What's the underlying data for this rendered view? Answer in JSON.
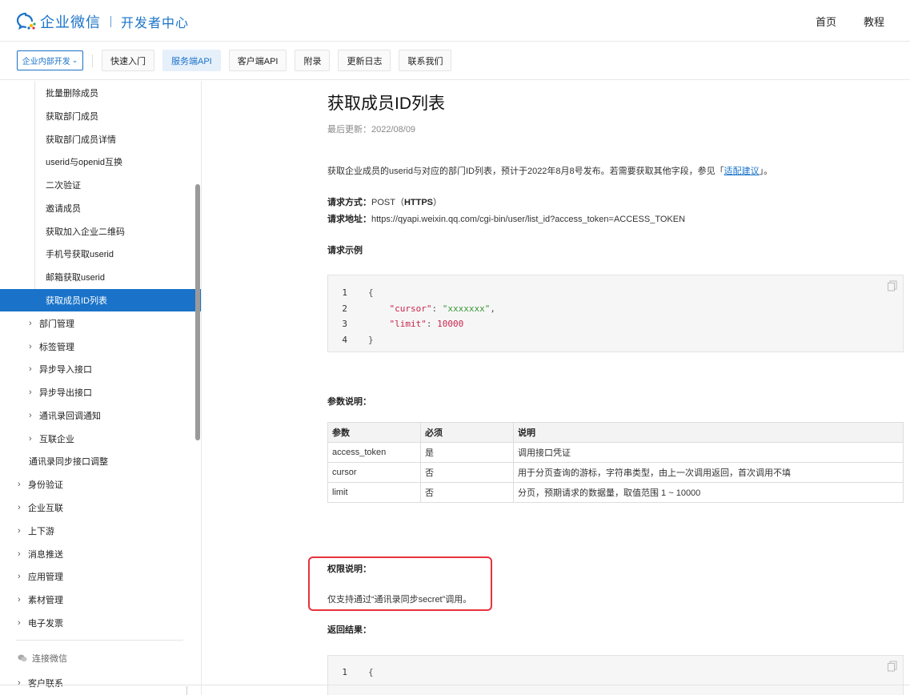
{
  "header": {
    "brand": "企业微信",
    "subtitle": "开发者中心",
    "nav": [
      "首页",
      "教程"
    ]
  },
  "subnav": {
    "dept_select": "企业内部开发",
    "tabs": [
      {
        "label": "快速入门",
        "active": false
      },
      {
        "label": "服务端API",
        "active": true
      },
      {
        "label": "客户端API",
        "active": false
      },
      {
        "label": "附录",
        "active": false
      },
      {
        "label": "更新日志",
        "active": false
      },
      {
        "label": "联系我们",
        "active": false
      }
    ]
  },
  "sidebar": {
    "sub_items": [
      "批量删除成员",
      "获取部门成员",
      "获取部门成员详情",
      "userid与openid互换",
      "二次验证",
      "邀请成员",
      "获取加入企业二维码",
      "手机号获取userid",
      "邮箱获取userid",
      "获取成员ID列表"
    ],
    "active_item": "获取成员ID列表",
    "groups": [
      "部门管理",
      "标签管理",
      "异步导入接口",
      "异步导出接口",
      "通讯录回调通知",
      "互联企业"
    ],
    "plain_item": "通讯录同步接口调整",
    "top_sections": [
      "身份验证",
      "企业互联",
      "上下游",
      "消息推送",
      "应用管理",
      "素材管理",
      "电子发票"
    ],
    "footer_link": "连接微信",
    "partial_item": "客户联系"
  },
  "article": {
    "title": "获取成员ID列表",
    "updated": "最后更新：2022/08/09",
    "intro_before": "获取企业成员的userid与对应的部门ID列表，预计于2022年8月8号发布。若需要获取其他字段，参见「",
    "intro_link": "适配建议",
    "intro_after": "」。",
    "method_label": "请求方式：",
    "method_value": "POST（",
    "method_proto": "HTTPS",
    "method_close": "）",
    "url_label": "请求地址：",
    "url_value": "https://qyapi.weixin.qq.com/cgi-bin/user/list_id?access_token=ACCESS_TOKEN",
    "example_label": "请求示例",
    "request_code": {
      "lines": [
        "1",
        "2",
        "3",
        "4"
      ],
      "open": "{",
      "cursor_key": "\"cursor\"",
      "cursor_val": "\"xxxxxxx\"",
      "limit_key": "\"limit\"",
      "limit_val": "10000",
      "close": "}"
    },
    "params_label": "参数说明：",
    "params_table": {
      "headers": [
        "参数",
        "必须",
        "说明"
      ],
      "rows": [
        [
          "access_token",
          "是",
          "调用接口凭证"
        ],
        [
          "cursor",
          "否",
          "用于分页查询的游标，字符串类型，由上一次调用返回，首次调用不填"
        ],
        [
          "limit",
          "否",
          "分页，预期请求的数据量，取值范围 1 ~ 10000"
        ]
      ]
    },
    "permission_label": "权限说明：",
    "permission_text": "仅支持通过“通讯录同步secret”调用。",
    "return_label": "返回结果：",
    "return_code": {
      "line": "1",
      "open": "{"
    }
  }
}
